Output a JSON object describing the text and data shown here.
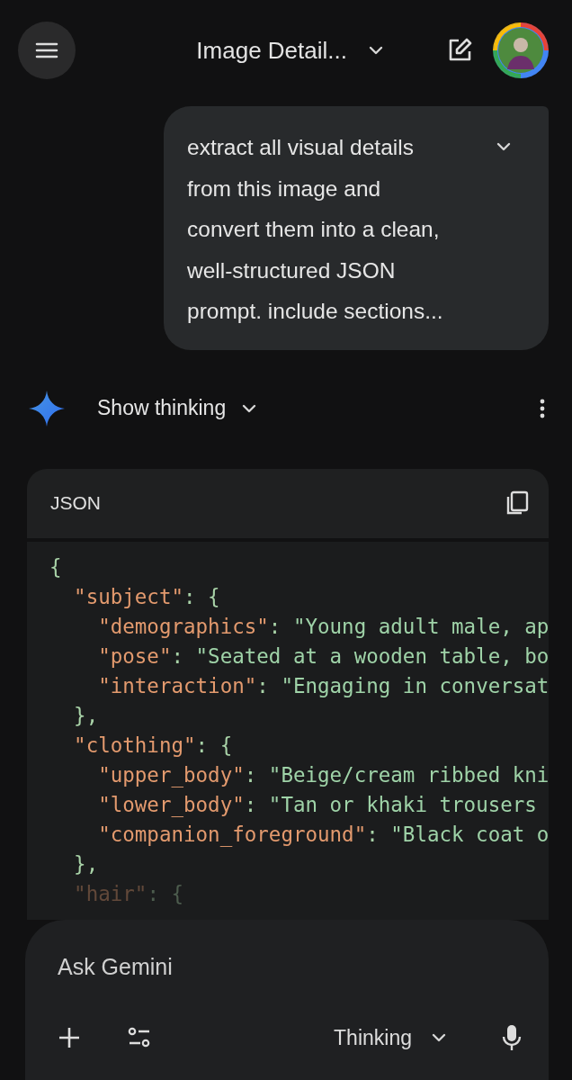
{
  "header": {
    "title": "Image Detail..."
  },
  "prompt": {
    "text": "extract all visual details from this image and convert them into a clean, well-structured JSON prompt. include sections...",
    "expanded": false
  },
  "response": {
    "thinking_label": "Show thinking",
    "thinking_expanded": false
  },
  "code_block": {
    "language": "JSON",
    "lines": [
      [
        {
          "kind": "punct",
          "text": "{"
        }
      ],
      [
        {
          "kind": "key",
          "text": "  \"subject\""
        },
        {
          "kind": "punct",
          "text": ": {"
        }
      ],
      [
        {
          "kind": "key",
          "text": "    \"demographics\""
        },
        {
          "kind": "punct",
          "text": ": "
        },
        {
          "kind": "string",
          "text": "\"Young adult male, ap"
        }
      ],
      [
        {
          "kind": "key",
          "text": "    \"pose\""
        },
        {
          "kind": "punct",
          "text": ": "
        },
        {
          "kind": "string",
          "text": "\"Seated at a wooden table, bo"
        }
      ],
      [
        {
          "kind": "key",
          "text": "    \"interaction\""
        },
        {
          "kind": "punct",
          "text": ": "
        },
        {
          "kind": "string",
          "text": "\"Engaging in conversat"
        }
      ],
      [
        {
          "kind": "punct",
          "text": "  },"
        }
      ],
      [
        {
          "kind": "key",
          "text": "  \"clothing\""
        },
        {
          "kind": "punct",
          "text": ": {"
        }
      ],
      [
        {
          "kind": "key",
          "text": "    \"upper_body\""
        },
        {
          "kind": "punct",
          "text": ": "
        },
        {
          "kind": "string",
          "text": "\"Beige/cream ribbed kni"
        }
      ],
      [
        {
          "kind": "key",
          "text": "    \"lower_body\""
        },
        {
          "kind": "punct",
          "text": ": "
        },
        {
          "kind": "string",
          "text": "\"Tan or khaki trousers"
        }
      ],
      [
        {
          "kind": "key",
          "text": "    \"companion_foreground\""
        },
        {
          "kind": "punct",
          "text": ": "
        },
        {
          "kind": "string",
          "text": "\"Black coat o"
        }
      ],
      [
        {
          "kind": "punct",
          "text": "  },"
        }
      ],
      [
        {
          "kind": "key",
          "text": "  \"hair\""
        },
        {
          "kind": "punct",
          "text": ": {"
        }
      ]
    ]
  },
  "input": {
    "placeholder": "Ask Gemini",
    "mode": "Thinking"
  }
}
